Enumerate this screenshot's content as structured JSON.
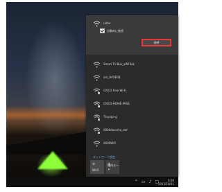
{
  "flyout": {
    "connected_network": {
      "name": "rulbo",
      "auto_connect_label": "自動的に接続",
      "connect_button": "接続"
    },
    "networks": [
      {
        "name": "Smart TV-Box_xWFKok",
        "icon": "wifi-icon"
      },
      {
        "name": "ark_94DE08",
        "icon": "wifi-icon"
      },
      {
        "name": "CISCO Free Wi-Fi",
        "icon": "wifi-secured-icon"
      },
      {
        "name": "CISCO-HOME-PASS",
        "icon": "wifi-secured-icon"
      },
      {
        "name": "Tinyoga-g",
        "icon": "wifi-secured-icon"
      },
      {
        "name": "0000docomo_dot",
        "icon": "wifi-secured-icon"
      },
      {
        "name": "0000WiFi",
        "icon": "wifi-icon"
      }
    ],
    "settings_link": "ネットワーク設定",
    "tiles": [
      {
        "label": "Wi-Fi",
        "icon": "wifi-tile-icon"
      },
      {
        "label": "機内モード",
        "icon": "airplane-icon"
      }
    ]
  },
  "taskbar": {
    "tray_icons": [
      "chevron-up-icon",
      "network-icon",
      "volume-icon",
      "input-icon"
    ],
    "clock_time": "0:00",
    "clock_date": "2015/10/01"
  },
  "colors": {
    "flyout_bg": "#2b2b2b",
    "highlight": "#e53935",
    "link": "#6aa9e6"
  }
}
